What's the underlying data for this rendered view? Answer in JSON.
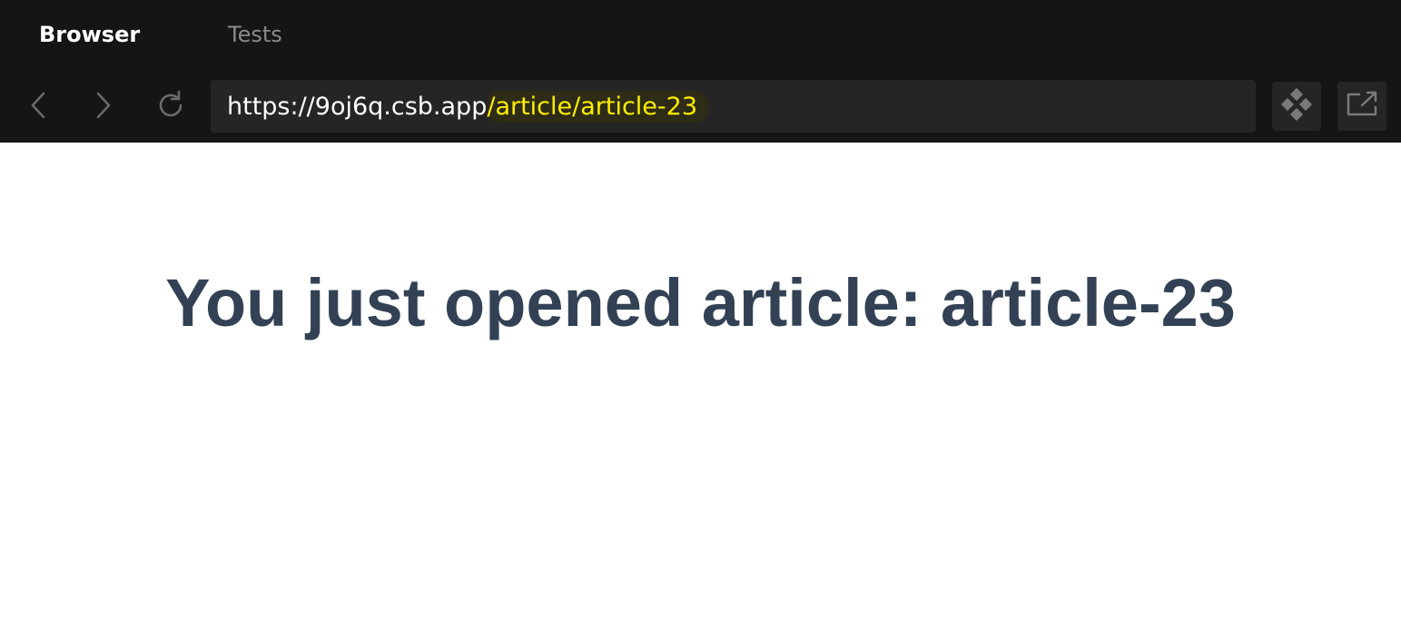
{
  "tabs": {
    "browser": "Browser",
    "tests": "Tests"
  },
  "address_bar": {
    "origin": "https://9oj6q.csb.app",
    "path": "/article/article-23"
  },
  "page": {
    "heading": "You just opened article: article-23"
  },
  "icons": {
    "back": "chevron-left-icon",
    "forward": "chevron-right-icon",
    "reload": "reload-icon",
    "devtools": "diamond-grid-icon",
    "open_external": "open-in-new-window-icon"
  },
  "colors": {
    "chrome_bg": "#151515",
    "url_bg": "#252525",
    "path_highlight": "#ffee00",
    "heading": "#334155",
    "inactive_tab": "#8a8a8a"
  }
}
